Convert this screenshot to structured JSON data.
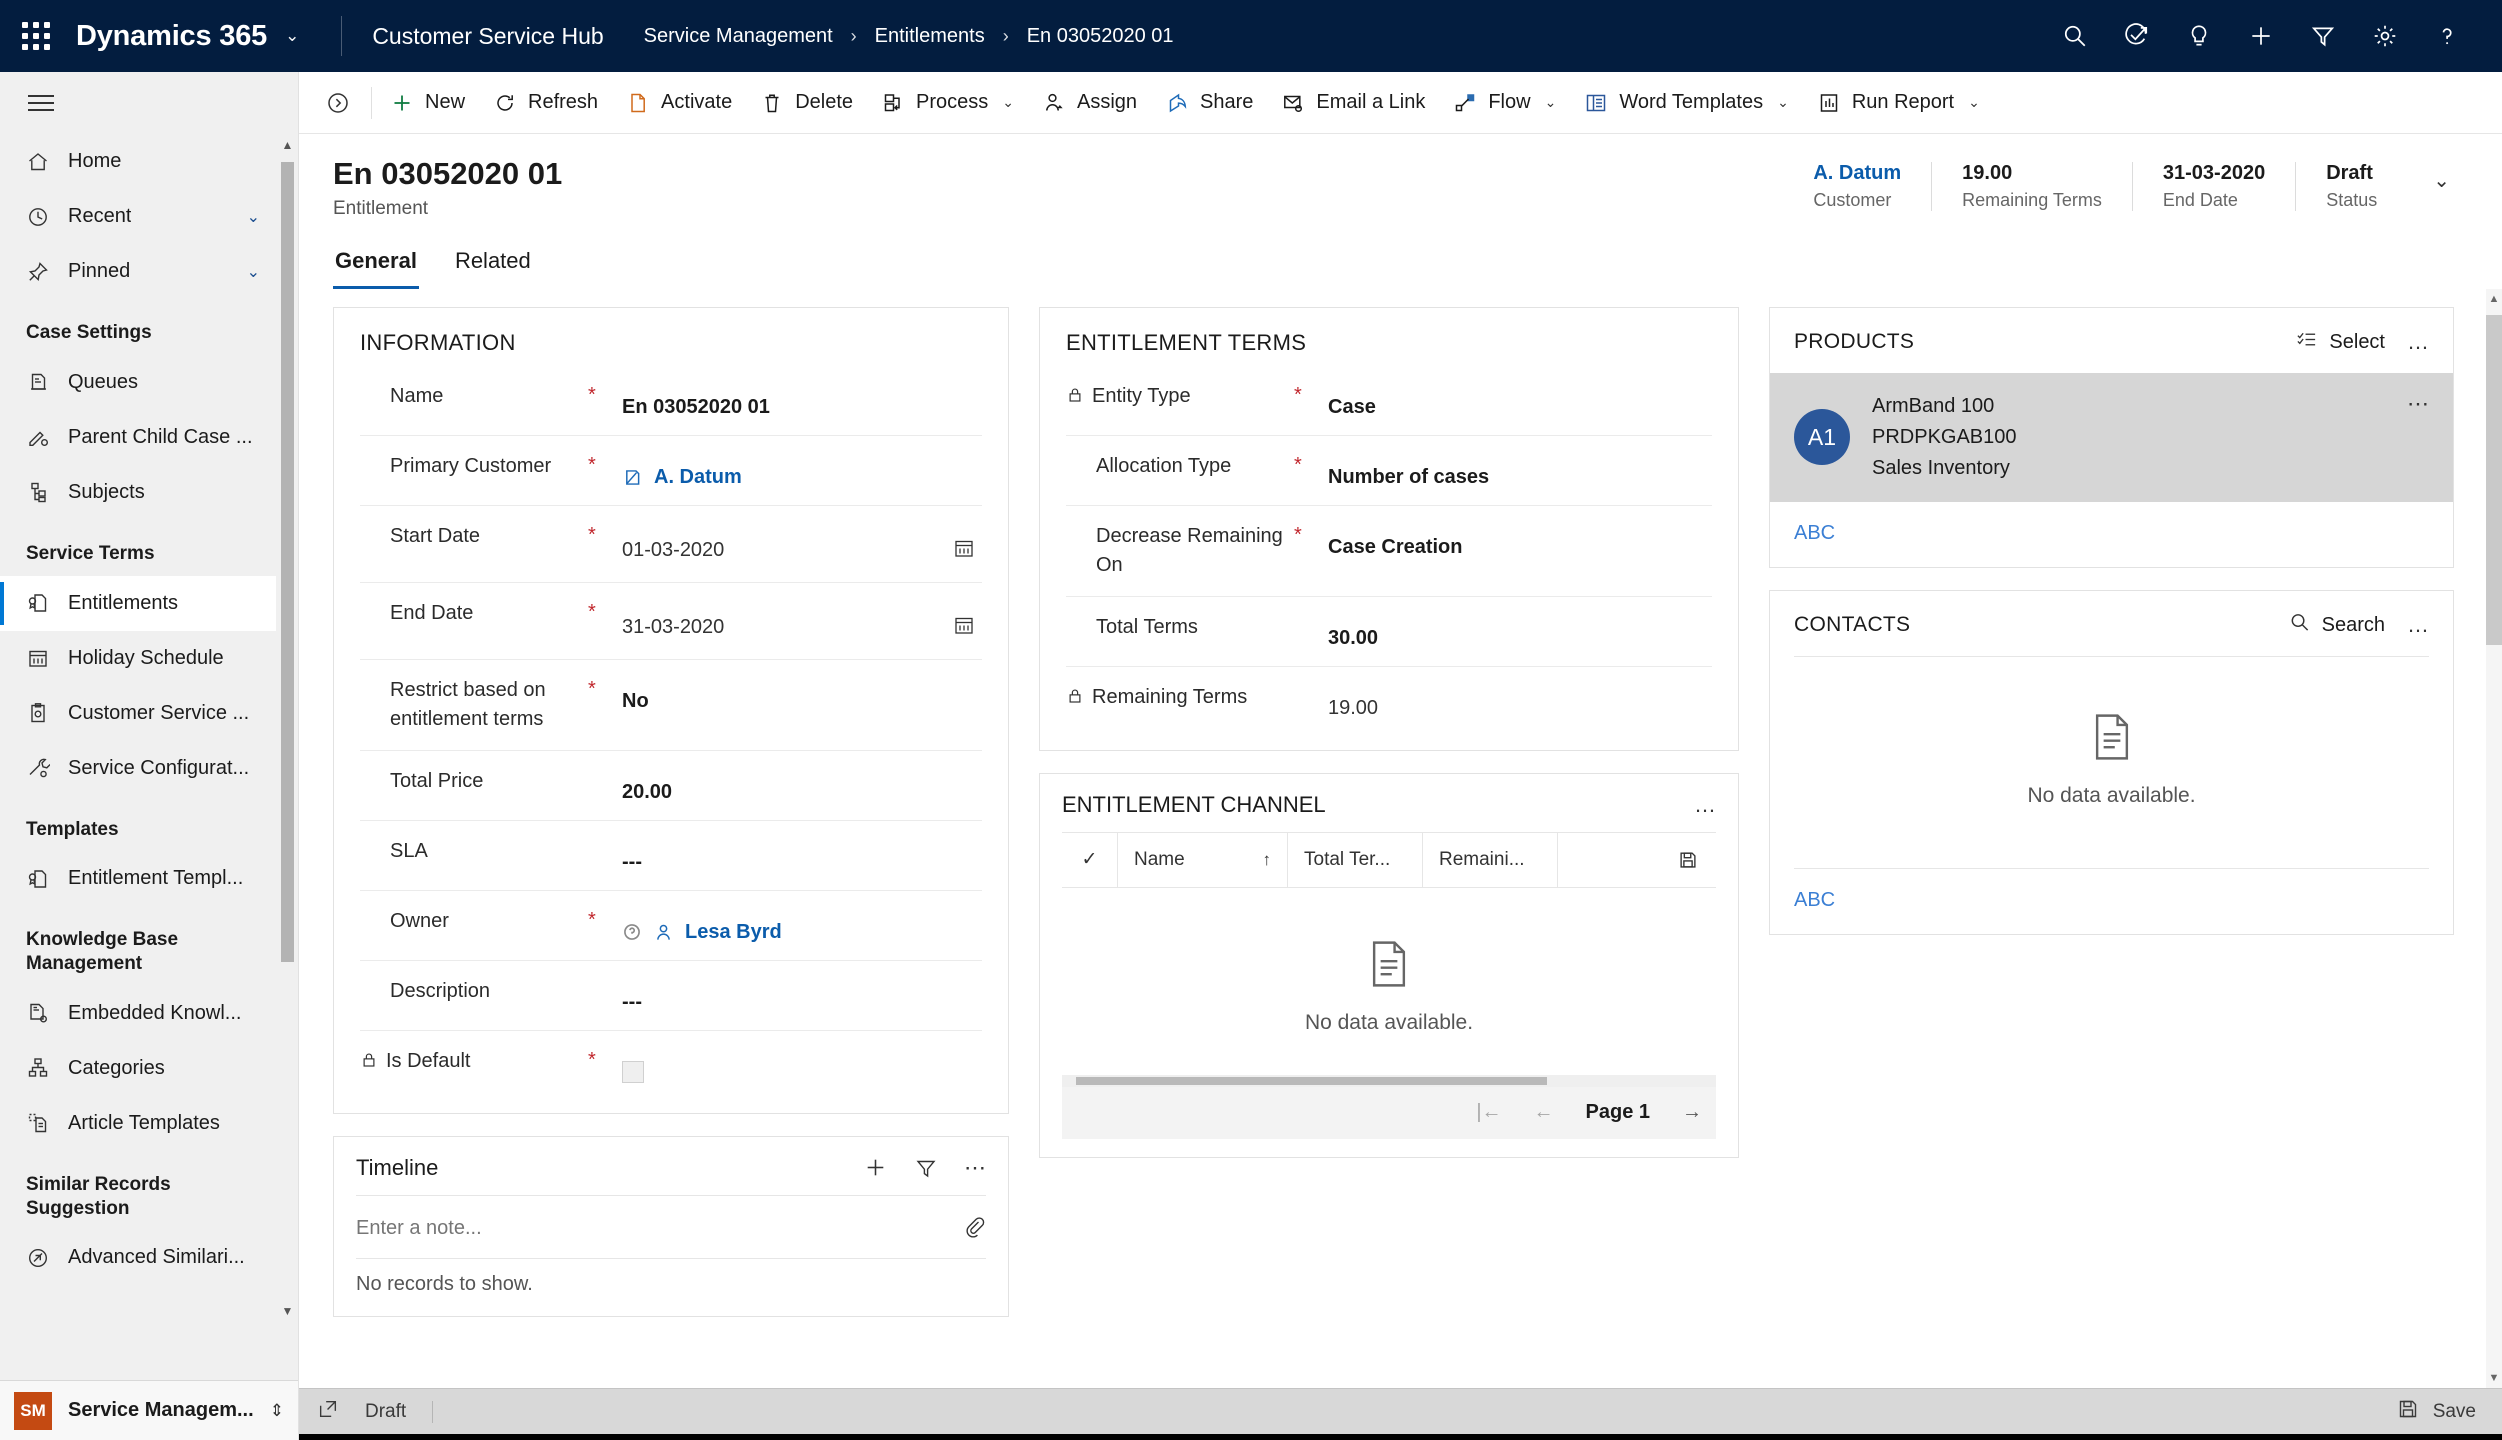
{
  "topbar": {
    "brand": "Dynamics 365",
    "app_name": "Customer Service Hub",
    "breadcrumbs": [
      "Service Management",
      "Entitlements",
      "En 03052020 01"
    ],
    "separator": "›",
    "actions": [
      "search-icon",
      "check-circle-arrow-icon",
      "lightbulb-icon",
      "plus-icon",
      "filter-icon",
      "gear-icon",
      "help-icon"
    ]
  },
  "sidebar": {
    "top_items": [
      {
        "label": "Home",
        "icon": "home-icon",
        "expandable": false
      },
      {
        "label": "Recent",
        "icon": "clock-icon",
        "expandable": true
      },
      {
        "label": "Pinned",
        "icon": "pin-icon",
        "expandable": true
      }
    ],
    "groups": [
      {
        "title": "Case Settings",
        "items": [
          {
            "label": "Queues",
            "icon": "queue-icon"
          },
          {
            "label": "Parent Child Case ...",
            "icon": "case-settings-icon"
          },
          {
            "label": "Subjects",
            "icon": "subjects-tree-icon"
          }
        ]
      },
      {
        "title": "Service Terms",
        "items": [
          {
            "label": "Entitlements",
            "icon": "entitlement-icon",
            "active": true
          },
          {
            "label": "Holiday Schedule",
            "icon": "calendar-icon"
          },
          {
            "label": "Customer Service ...",
            "icon": "clipboard-gear-icon"
          },
          {
            "label": "Service Configurat...",
            "icon": "wrench-gear-icon"
          }
        ]
      },
      {
        "title": "Templates",
        "items": [
          {
            "label": "Entitlement Templ...",
            "icon": "entitlement-icon"
          }
        ]
      },
      {
        "title": "Knowledge Base Management",
        "items": [
          {
            "label": "Embedded Knowl...",
            "icon": "embedded-knowledge-icon"
          },
          {
            "label": "Categories",
            "icon": "categories-icon"
          },
          {
            "label": "Article Templates",
            "icon": "article-template-icon"
          }
        ]
      },
      {
        "title": "Similar Records Suggestion",
        "items": [
          {
            "label": "Advanced Similari...",
            "icon": "similarity-icon"
          }
        ]
      }
    ],
    "footer": {
      "badge": "SM",
      "name": "Service Managem...",
      "chevron": "⌃⌄"
    }
  },
  "commandbar": {
    "items": [
      {
        "label": "New",
        "icon": "plus-icon",
        "chevron": false
      },
      {
        "label": "Refresh",
        "icon": "refresh-icon",
        "chevron": false
      },
      {
        "label": "Activate",
        "icon": "activate-page-icon",
        "chevron": false
      },
      {
        "label": "Delete",
        "icon": "trash-icon",
        "chevron": false
      },
      {
        "label": "Process",
        "icon": "process-icon",
        "chevron": true
      },
      {
        "label": "Assign",
        "icon": "assign-person-icon",
        "chevron": false
      },
      {
        "label": "Share",
        "icon": "share-icon",
        "chevron": false
      },
      {
        "label": "Email a Link",
        "icon": "email-link-icon",
        "chevron": false
      },
      {
        "label": "Flow",
        "icon": "flow-icon",
        "chevron": true
      },
      {
        "label": "Word Templates",
        "icon": "word-templates-icon",
        "chevron": true
      },
      {
        "label": "Run Report",
        "icon": "run-report-icon",
        "chevron": true
      }
    ]
  },
  "record": {
    "title": "En 03052020 01",
    "subtitle": "Entitlement",
    "header_fields": [
      {
        "value": "A. Datum",
        "label": "Customer",
        "is_link": true
      },
      {
        "value": "19.00",
        "label": "Remaining Terms",
        "is_link": false
      },
      {
        "value": "31-03-2020",
        "label": "End Date",
        "is_link": false
      },
      {
        "value": "Draft",
        "label": "Status",
        "is_link": false
      }
    ],
    "tabs": [
      {
        "label": "General",
        "active": true
      },
      {
        "label": "Related",
        "active": false
      }
    ]
  },
  "information": {
    "title": "INFORMATION",
    "fields": [
      {
        "label": "Name",
        "required": true,
        "value": "En 03052020 01",
        "type": "text"
      },
      {
        "label": "Primary Customer",
        "required": true,
        "value": "A. Datum",
        "type": "lookup-account"
      },
      {
        "label": "Start Date",
        "required": true,
        "value": "01-03-2020",
        "type": "date"
      },
      {
        "label": "End Date",
        "required": true,
        "value": "31-03-2020",
        "type": "date"
      },
      {
        "label": "Restrict based on entitlement terms",
        "required": true,
        "value": "No",
        "type": "text"
      },
      {
        "label": "Total Price",
        "required": false,
        "value": "20.00",
        "type": "text"
      },
      {
        "label": "SLA",
        "required": false,
        "value": "---",
        "type": "empty"
      },
      {
        "label": "Owner",
        "required": true,
        "value": "Lesa Byrd",
        "type": "lookup-user"
      },
      {
        "label": "Description",
        "required": false,
        "value": "---",
        "type": "empty"
      },
      {
        "label": "Is Default",
        "required": true,
        "value": "",
        "type": "checkbox",
        "locked": true
      }
    ]
  },
  "entitlement_terms": {
    "title": "ENTITLEMENT TERMS",
    "fields": [
      {
        "label": "Entity Type",
        "required": true,
        "value": "Case",
        "locked": true
      },
      {
        "label": "Allocation Type",
        "required": true,
        "value": "Number of cases",
        "locked": false
      },
      {
        "label": "Decrease Remaining On",
        "required": true,
        "value": "Case Creation",
        "locked": false
      },
      {
        "label": "Total Terms",
        "required": false,
        "value": "30.00",
        "locked": false
      },
      {
        "label": "Remaining Terms",
        "required": false,
        "value": "19.00",
        "locked": true
      }
    ]
  },
  "entitlement_channel": {
    "title": "ENTITLEMENT CHANNEL",
    "more_label": "…",
    "columns": [
      "Name",
      "Total Ter...",
      "Remaini..."
    ],
    "sort_indicator": "↑",
    "empty_message": "No data available.",
    "pager": {
      "first": "|←",
      "prev": "←",
      "page": "Page 1",
      "next": "→"
    }
  },
  "timeline": {
    "title": "Timeline",
    "add_label": "+",
    "note_placeholder": "Enter a note...",
    "empty_message": "No records to show."
  },
  "products": {
    "title": "PRODUCTS",
    "select_label": "Select",
    "more_label": "…",
    "items": [
      {
        "initials": "A1",
        "name": "ArmBand 100",
        "code": "PRDPKGAB100",
        "category": "Sales Inventory"
      }
    ],
    "footer_link": "ABC"
  },
  "contacts": {
    "title": "CONTACTS",
    "search_label": "Search",
    "more_label": "…",
    "empty_message": "No data available.",
    "footer_link": "ABC"
  },
  "statusbar": {
    "status": "Draft",
    "save_label": "Save"
  },
  "colors": {
    "topbar_bg": "#031D3F",
    "accent_blue": "#0b5cab",
    "required_red": "#c1272d",
    "badge_orange": "#c44a12",
    "avatar_blue": "#2b579a",
    "active_nav": "#0078d4"
  }
}
